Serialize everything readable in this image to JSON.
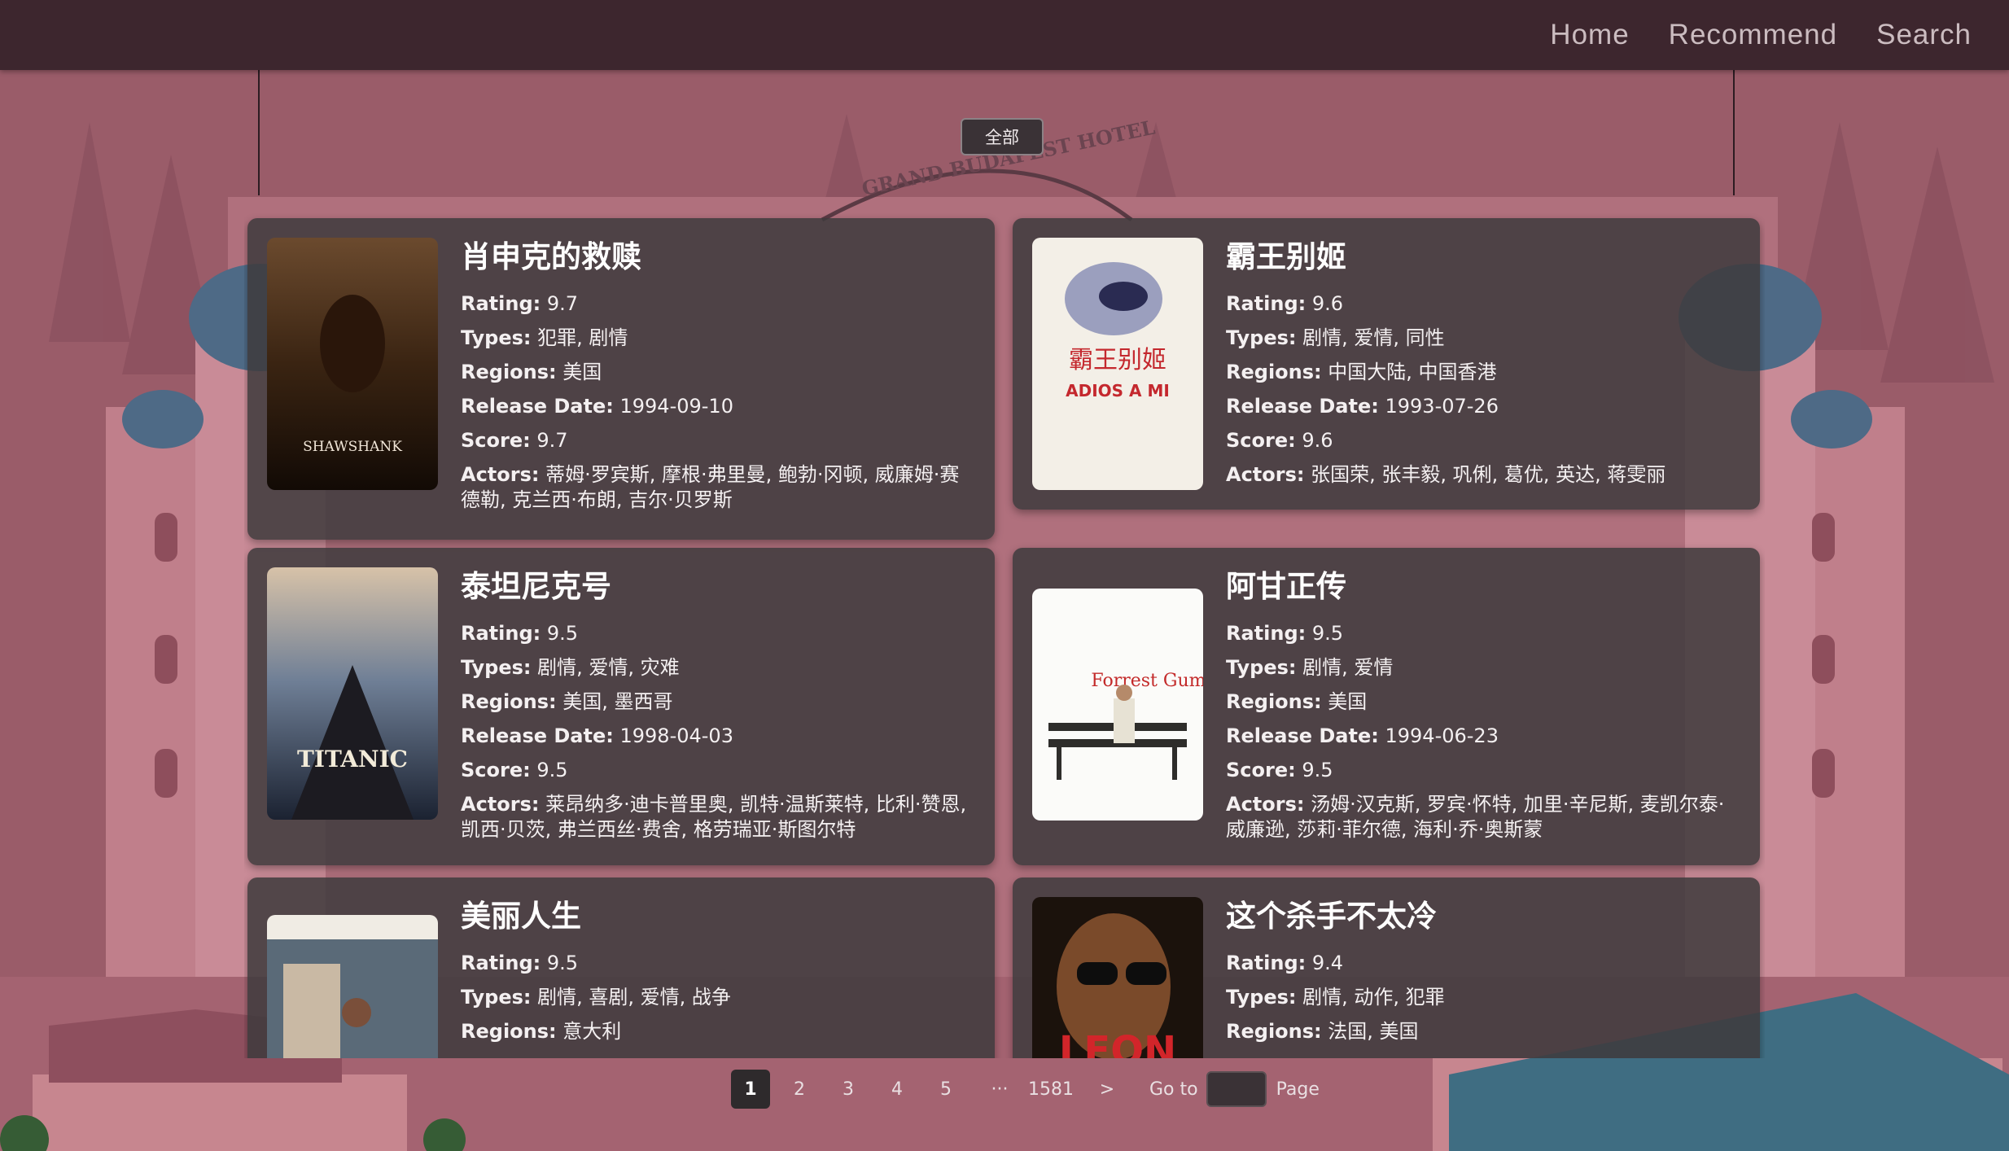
{
  "nav": {
    "items": [
      "Home",
      "Recommend",
      "Search"
    ]
  },
  "filter": {
    "selected": "全部"
  },
  "background": {
    "sign_text": "GRAND BUDAPEST HOTEL"
  },
  "labels": {
    "rating": "Rating:",
    "types": "Types:",
    "regions": "Regions:",
    "release_date": "Release Date:",
    "score": "Score:",
    "actors": "Actors:"
  },
  "movies": [
    {
      "title": "肖申克的救赎",
      "rating": "9.7",
      "types": "犯罪, 剧情",
      "regions": "美国",
      "release_date": "1994-09-10",
      "score": "9.7",
      "actors": "蒂姆·罗宾斯, 摩根·弗里曼, 鲍勃·冈顿, 威廉姆·赛德勒, 克兰西·布朗, 吉尔·贝罗斯",
      "poster_text": "SHAWSHANK"
    },
    {
      "title": "霸王别姬",
      "rating": "9.6",
      "types": "剧情, 爱情, 同性",
      "regions": "中国大陆, 中国香港",
      "release_date": "1993-07-26",
      "score": "9.6",
      "actors": "张国荣, 张丰毅, 巩俐, 葛优, 英达, 蒋雯丽",
      "poster_text": "ADIOS A MI"
    },
    {
      "title": "泰坦尼克号",
      "rating": "9.5",
      "types": "剧情, 爱情, 灾难",
      "regions": "美国, 墨西哥",
      "release_date": "1998-04-03",
      "score": "9.5",
      "actors": "莱昂纳多·迪卡普里奥, 凯特·温斯莱特, 比利·赞恩, 凯西·贝茨, 弗兰西丝·费舍, 格劳瑞亚·斯图尔特",
      "poster_text": "TITANIC"
    },
    {
      "title": "阿甘正传",
      "rating": "9.5",
      "types": "剧情, 爱情",
      "regions": "美国",
      "release_date": "1994-06-23",
      "score": "9.5",
      "actors": "汤姆·汉克斯, 罗宾·怀特, 加里·辛尼斯, 麦凯尔泰·威廉逊, 莎莉·菲尔德, 海利·乔·奥斯蒙",
      "poster_text": "Forrest Gump"
    },
    {
      "title": "美丽人生",
      "rating": "9.5",
      "types": "剧情, 喜剧, 爱情, 战争",
      "regions": "意大利",
      "release_date": "",
      "score": "",
      "actors": "",
      "poster_text": ""
    },
    {
      "title": "这个杀手不太冷",
      "rating": "9.4",
      "types": "剧情, 动作, 犯罪",
      "regions": "法国, 美国",
      "release_date": "",
      "score": "",
      "actors": "",
      "poster_text": "LEON"
    }
  ],
  "pagination": {
    "pages": [
      "1",
      "2",
      "3",
      "4",
      "5"
    ],
    "current": "1",
    "ellipsis": "···",
    "last": "1581",
    "next": ">",
    "goto_label": "Go to",
    "goto_value": "",
    "page_label": "Page"
  },
  "colors": {
    "nav_bg": "#3d262e",
    "card_bg": "#3e3a3c",
    "page_bg": "#9c5f6b"
  }
}
